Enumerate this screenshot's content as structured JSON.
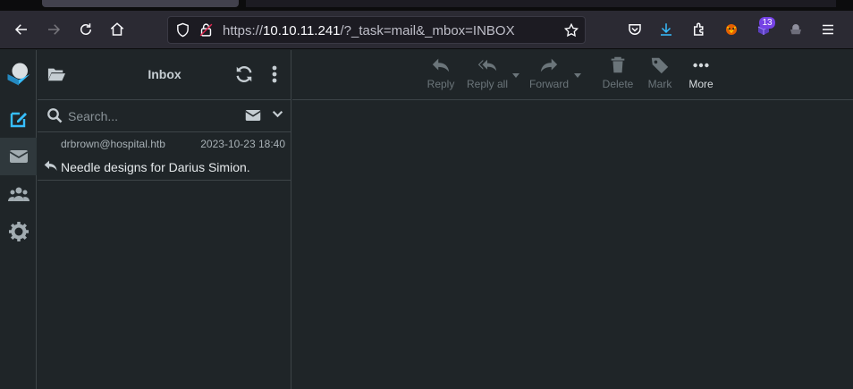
{
  "browser": {
    "url_prefix": "https://",
    "url_host": "10.10.11.241",
    "url_path": "/?_task=mail&_mbox=INBOX",
    "extension_badge": "13"
  },
  "list": {
    "title": "Inbox",
    "search_placeholder": "Search..."
  },
  "messages": [
    {
      "from": "drbrown@hospital.htb",
      "date": "2023-10-23 18:40",
      "subject": "Needle designs for Darius Simion."
    }
  ],
  "toolbar": {
    "reply": "Reply",
    "reply_all": "Reply all",
    "forward": "Forward",
    "delete": "Delete",
    "mark": "Mark",
    "more": "More"
  },
  "colors": {
    "accent": "#37beff",
    "background": "#1f2528",
    "border": "#3d4448"
  }
}
